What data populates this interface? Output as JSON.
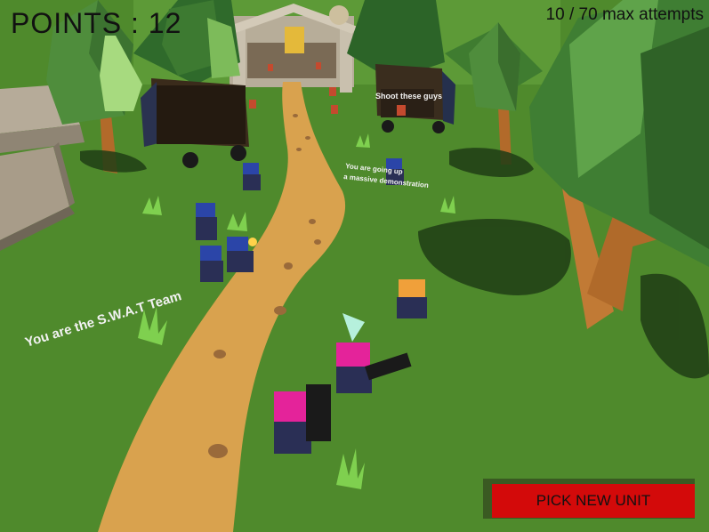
{
  "hud": {
    "points_label": "POINTS : 12",
    "attempts_label": "10 / 70 max attempts"
  },
  "world_labels": {
    "swat_team": "You are the S.W.A.T Team",
    "shoot_guys": "Shoot these guys",
    "going_up_line1": "You are going up",
    "going_up_line2": "a massive demonstration"
  },
  "button": {
    "pick_new_unit": "PICK NEW UNIT"
  },
  "colors": {
    "grass": "#4f8a2c",
    "path": "#d9a24e",
    "button": "#d30a0a",
    "swat_blue": "#2b45a8",
    "player_pink": "#e4239a"
  }
}
